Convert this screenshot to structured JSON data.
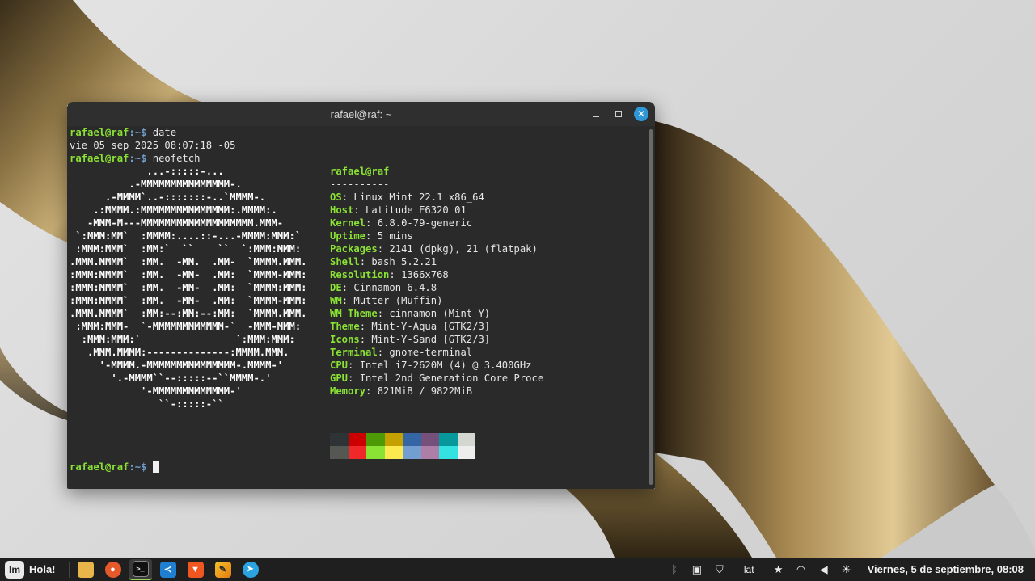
{
  "terminal": {
    "title": "rafael@raf: ~",
    "prompt_user": "rafael@raf",
    "prompt_path": ":~$ ",
    "cmd1": "date",
    "date_output": "vie 05 sep 2025 08:07:18 -05",
    "cmd2": "neofetch"
  },
  "neofetch": {
    "ascii": [
      "             ...-:::::-...",
      "          .-MMMMMMMMMMMMMMM-.",
      "      .-MMMM`..-:::::::-..`MMMM-.",
      "    .:MMMM.:MMMMMMMMMMMMMMM:.MMMM:.",
      "   -MMM-M---MMMMMMMMMMMMMMMMMMM.MMM-",
      " `:MMM:MM`  :MMMM:....::-...-MMMM:MMM:`",
      " :MMM:MMM`  :MM:`  ``    ``  `:MMM:MMM:",
      ".MMM.MMMM`  :MM.  -MM.  .MM-  `MMMM.MMM.",
      ":MMM:MMMM`  :MM.  -MM-  .MM:  `MMMM-MMM:",
      ":MMM:MMMM`  :MM.  -MM-  .MM:  `MMMM:MMM:",
      ":MMM:MMMM`  :MM.  -MM-  .MM:  `MMMM-MMM:",
      ".MMM.MMMM`  :MM:--:MM:--:MM:  `MMMM.MMM.",
      " :MMM:MMM-  `-MMMMMMMMMMMM-`  -MMM-MMM:",
      "  :MMM:MMM:`                `:MMM:MMM:",
      "   .MMM.MMMM:--------------:MMMM.MMM.",
      "     '-MMMM.-MMMMMMMMMMMMMMM-.MMMM-'",
      "       '.-MMMM``--:::::--``MMMM-.'",
      "            '-MMMMMMMMMMMMM-'",
      "               ``-:::::-``"
    ],
    "header": "rafael@raf",
    "underline": "----------",
    "rows": [
      {
        "key": "OS",
        "value": "Linux Mint 22.1 x86_64"
      },
      {
        "key": "Host",
        "value": "Latitude E6320 01"
      },
      {
        "key": "Kernel",
        "value": "6.8.0-79-generic"
      },
      {
        "key": "Uptime",
        "value": "5 mins"
      },
      {
        "key": "Packages",
        "value": "2141 (dpkg), 21 (flatpak)"
      },
      {
        "key": "Shell",
        "value": "bash 5.2.21"
      },
      {
        "key": "Resolution",
        "value": "1366x768"
      },
      {
        "key": "DE",
        "value": "Cinnamon 6.4.8"
      },
      {
        "key": "WM",
        "value": "Mutter (Muffin)"
      },
      {
        "key": "WM Theme",
        "value": "cinnamon (Mint-Y)"
      },
      {
        "key": "Theme",
        "value": "Mint-Y-Aqua [GTK2/3]"
      },
      {
        "key": "Icons",
        "value": "Mint-Y-Sand [GTK2/3]"
      },
      {
        "key": "Terminal",
        "value": "gnome-terminal"
      },
      {
        "key": "CPU",
        "value": "Intel i7-2620M (4) @ 3.400GHz"
      },
      {
        "key": "GPU",
        "value": "Intel 2nd Generation Core Proce"
      },
      {
        "key": "Memory",
        "value": "821MiB / 9822MiB"
      }
    ],
    "palette_top": [
      "#2e3436",
      "#cc0000",
      "#4e9a06",
      "#c4a000",
      "#3465a4",
      "#75507b",
      "#06989a",
      "#d3d7cf"
    ],
    "palette_bottom": [
      "#555753",
      "#ef2929",
      "#8ae234",
      "#fce94f",
      "#729fcf",
      "#ad7fa8",
      "#34e2e2",
      "#eeeeec"
    ]
  },
  "taskbar": {
    "start_label": "Hola!",
    "keyboard_layout": "lat",
    "clock": "Viernes, 5 de septiembre, 08:08",
    "apps": [
      "files-icon",
      "firefox-icon",
      "terminal-icon",
      "vscode-icon",
      "brave-icon",
      "drawing-app-icon",
      "telegram-icon"
    ]
  },
  "colors": {
    "prompt_green": "#8ae234",
    "path_blue": "#729fcf",
    "close_blue": "#2f97d8",
    "terminal_bg": "#2a2a2a"
  }
}
